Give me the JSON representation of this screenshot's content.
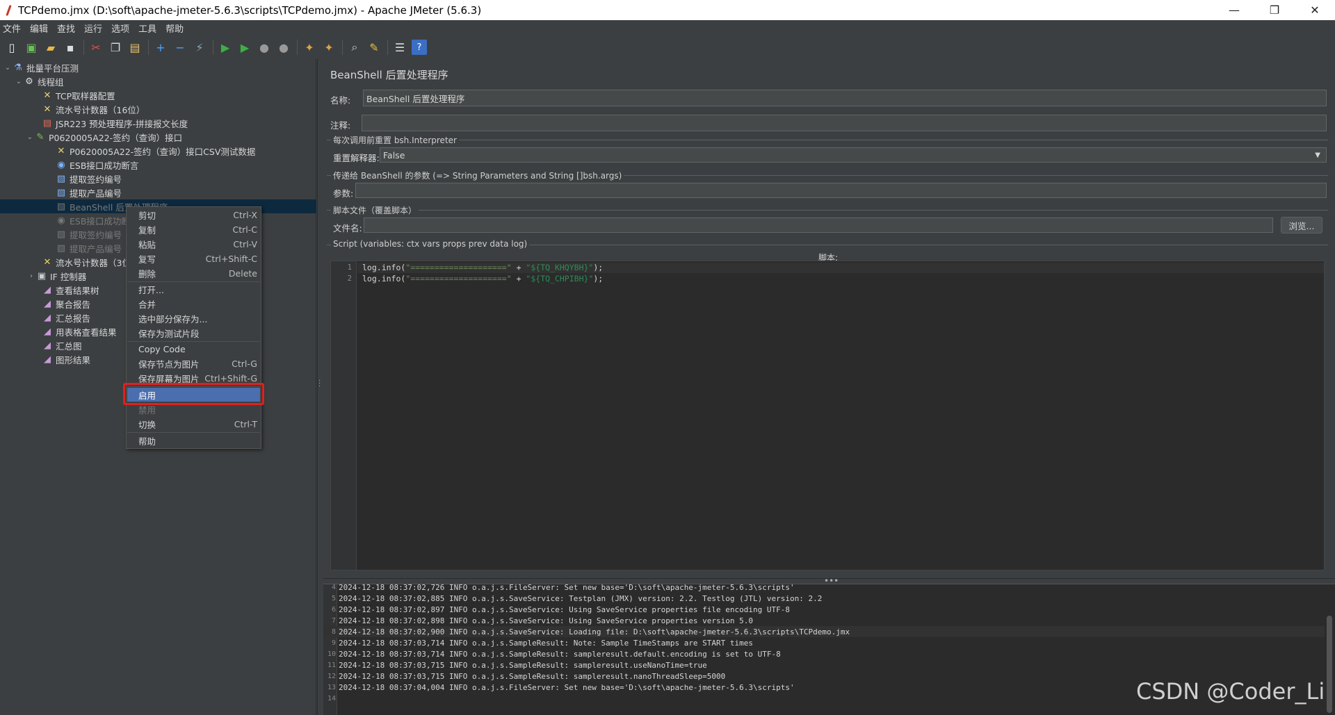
{
  "window": {
    "title": "TCPdemo.jmx (D:\\soft\\apache-jmeter-5.6.3\\scripts\\TCPdemo.jmx) - Apache JMeter (5.6.3)",
    "minimize": "—",
    "restore": "❐",
    "close": "✕"
  },
  "menubar": [
    "文件",
    "编辑",
    "查找",
    "运行",
    "选项",
    "工具",
    "帮助"
  ],
  "tree": {
    "items": [
      {
        "label": "批量平台压测",
        "icon": "flask-icon"
      },
      {
        "label": "线程组",
        "icon": "gear-icon"
      },
      {
        "label": "TCP取样器配置",
        "icon": "tools-icon"
      },
      {
        "label": "流水号计数器（16位）",
        "icon": "tools-icon"
      },
      {
        "label": "JSR223 预处理程序-拼接报文长度",
        "icon": "script-icon"
      },
      {
        "label": "P0620005A22-签约（查询）接口",
        "icon": "pipette-icon"
      },
      {
        "label": "P0620005A22-签约（查询）接口CSV测试数据",
        "icon": "tools-icon"
      },
      {
        "label": "ESB接口成功断言",
        "icon": "assert-icon"
      },
      {
        "label": "提取签约编号",
        "icon": "doc-icon"
      },
      {
        "label": "提取产品编号",
        "icon": "doc-icon"
      },
      {
        "label": "BeanShell 后置处理程序",
        "icon": "doc-icon"
      },
      {
        "label": "ESB接口成功断",
        "icon": "assert-icon"
      },
      {
        "label": "提取签约编号",
        "icon": "doc-icon"
      },
      {
        "label": "提取产品编号",
        "icon": "doc-icon"
      },
      {
        "label": "流水号计数器（3位",
        "icon": "tools-icon"
      },
      {
        "label": "IF 控制器",
        "icon": "if-icon"
      },
      {
        "label": "查看结果树",
        "icon": "graph-icon"
      },
      {
        "label": "聚合报告",
        "icon": "graph-icon"
      },
      {
        "label": "汇总报告",
        "icon": "graph-icon"
      },
      {
        "label": "用表格查看结果",
        "icon": "graph-icon"
      },
      {
        "label": "汇总图",
        "icon": "graph-icon"
      },
      {
        "label": "图形结果",
        "icon": "graph-icon"
      }
    ]
  },
  "context_menu": {
    "items": [
      {
        "label": "剪切",
        "key": "Ctrl-X"
      },
      {
        "label": "复制",
        "key": "Ctrl-C"
      },
      {
        "label": "粘贴",
        "key": "Ctrl-V"
      },
      {
        "label": "复写",
        "key": "Ctrl+Shift-C"
      },
      {
        "label": "删除",
        "key": "Delete"
      },
      {
        "label": "打开...",
        "key": ""
      },
      {
        "label": "合并",
        "key": ""
      },
      {
        "label": "选中部分保存为...",
        "key": ""
      },
      {
        "label": "保存为测试片段",
        "key": ""
      },
      {
        "label": "Copy Code",
        "key": ""
      },
      {
        "label": "保存节点为图片",
        "key": "Ctrl-G"
      },
      {
        "label": "保存屏幕为图片",
        "key": "Ctrl+Shift-G"
      },
      {
        "label": "启用",
        "key": ""
      },
      {
        "label": "禁用",
        "key": ""
      },
      {
        "label": "切换",
        "key": "Ctrl-T"
      },
      {
        "label": "帮助",
        "key": ""
      }
    ]
  },
  "panel": {
    "title": "BeanShell 后置处理程序",
    "name_label": "名称:",
    "name_value": "BeanShell 后置处理程序",
    "comment_label": "注释:",
    "comment_value": "",
    "reset_group": "每次调用前重置 bsh.Interpreter",
    "reset_label": "重置解释器:",
    "reset_value": "False",
    "params_group": "传递给 BeanShell 的参数 (=> String Parameters and String []bsh.args)",
    "params_label": "参数:",
    "params_value": "",
    "file_group": "脚本文件（覆盖脚本）",
    "file_label": "文件名:",
    "file_value": "",
    "browse": "浏览...",
    "script_group": "Script (variables: ctx vars props prev data log)",
    "script_label": "脚本:"
  },
  "script_lines": [
    {
      "n": "1",
      "pre": "log.info(",
      "s1": "\"====================\"",
      "mid": " + ",
      "s2": "\"${TQ_KHQYBH}\"",
      "post": ");"
    },
    {
      "n": "2",
      "pre": "log.info(",
      "s1": "\"====================\"",
      "mid": " + ",
      "s2": "\"${TQ_CHPIBH}\"",
      "post": ");"
    }
  ],
  "log_lines": [
    {
      "n": "4",
      "t": "2024-12-18 08:37:02,726 INFO o.a.j.s.FileServer: Set new base='D:\\soft\\apache-jmeter-5.6.3\\scripts'"
    },
    {
      "n": "5",
      "t": "2024-12-18 08:37:02,885 INFO o.a.j.s.SaveService: Testplan (JMX) version: 2.2. Testlog (JTL) version: 2.2"
    },
    {
      "n": "6",
      "t": "2024-12-18 08:37:02,897 INFO o.a.j.s.SaveService: Using SaveService properties file encoding UTF-8"
    },
    {
      "n": "7",
      "t": "2024-12-18 08:37:02,898 INFO o.a.j.s.SaveService: Using SaveService properties version 5.0"
    },
    {
      "n": "8",
      "t": "2024-12-18 08:37:02,900 INFO o.a.j.s.SaveService: Loading file: D:\\soft\\apache-jmeter-5.6.3\\scripts\\TCPdemo.jmx"
    },
    {
      "n": "9",
      "t": "2024-12-18 08:37:03,714 INFO o.a.j.s.SampleResult: Note: Sample TimeStamps are START times"
    },
    {
      "n": "10",
      "t": "2024-12-18 08:37:03,714 INFO o.a.j.s.SampleResult: sampleresult.default.encoding is set to UTF-8"
    },
    {
      "n": "11",
      "t": "2024-12-18 08:37:03,715 INFO o.a.j.s.SampleResult: sampleresult.useNanoTime=true"
    },
    {
      "n": "12",
      "t": "2024-12-18 08:37:03,715 INFO o.a.j.s.SampleResult: sampleresult.nanoThreadSleep=5000"
    },
    {
      "n": "13",
      "t": "2024-12-18 08:37:04,004 INFO o.a.j.s.FileServer: Set new base='D:\\soft\\apache-jmeter-5.6.3\\scripts'"
    },
    {
      "n": "14",
      "t": ""
    }
  ],
  "watermark": "CSDN @Coder_Li"
}
